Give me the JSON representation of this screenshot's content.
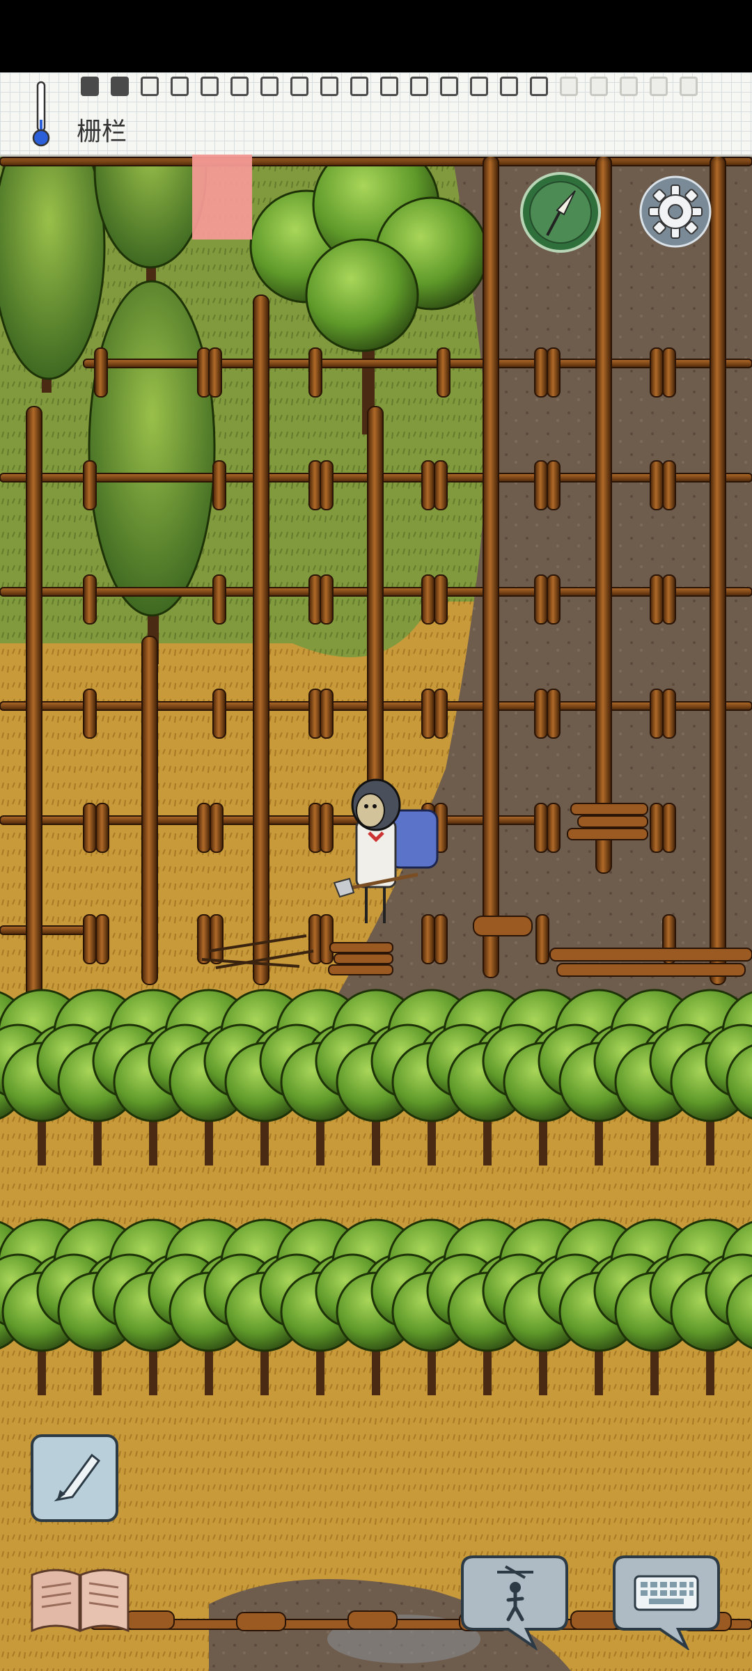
{
  "hud": {
    "hover_object_label": "栅栏",
    "food_meter": {
      "filled": 2,
      "empty": 14,
      "faded": 5
    }
  },
  "icons": {
    "thermometer": "thermometer-icon",
    "compass": "compass-icon",
    "settings": "gear-icon",
    "pencil": "pencil-icon",
    "book": "book-icon",
    "emote": "puppet-speech-icon",
    "keyboard": "keyboard-speech-icon"
  },
  "colors": {
    "grass": "#7f9a3c",
    "dry_grass": "#c99a3a",
    "dirt": "#6e5c4d",
    "fence_wood": "#8a4f1c",
    "tree_leaf": "#5f9a2a",
    "panel_paper": "#f6f6f3",
    "thermometer_blue": "#2b5fd9"
  }
}
